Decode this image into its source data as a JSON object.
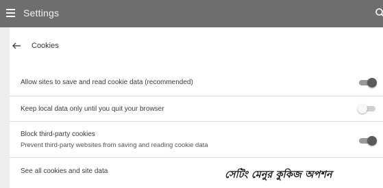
{
  "header": {
    "title": "Settings",
    "menu_icon": "hamburger-menu-icon",
    "search_icon": "search-icon",
    "background": "#6e6e6e"
  },
  "subpage": {
    "back_icon": "back-arrow-icon",
    "title": "Cookies"
  },
  "settings": [
    {
      "label": "Allow sites to save and read cookie data (recommended)",
      "toggle": "on"
    },
    {
      "label": "Keep local data only until you quit your browser",
      "toggle": "off"
    },
    {
      "label": "Block third-party cookies",
      "description": "Prevent third-party websites from saving and reading cookie data",
      "toggle": "on"
    },
    {
      "label": "See all cookies and site data"
    }
  ],
  "caption": "সেটিং মেনুর কুকিজ অপশন"
}
